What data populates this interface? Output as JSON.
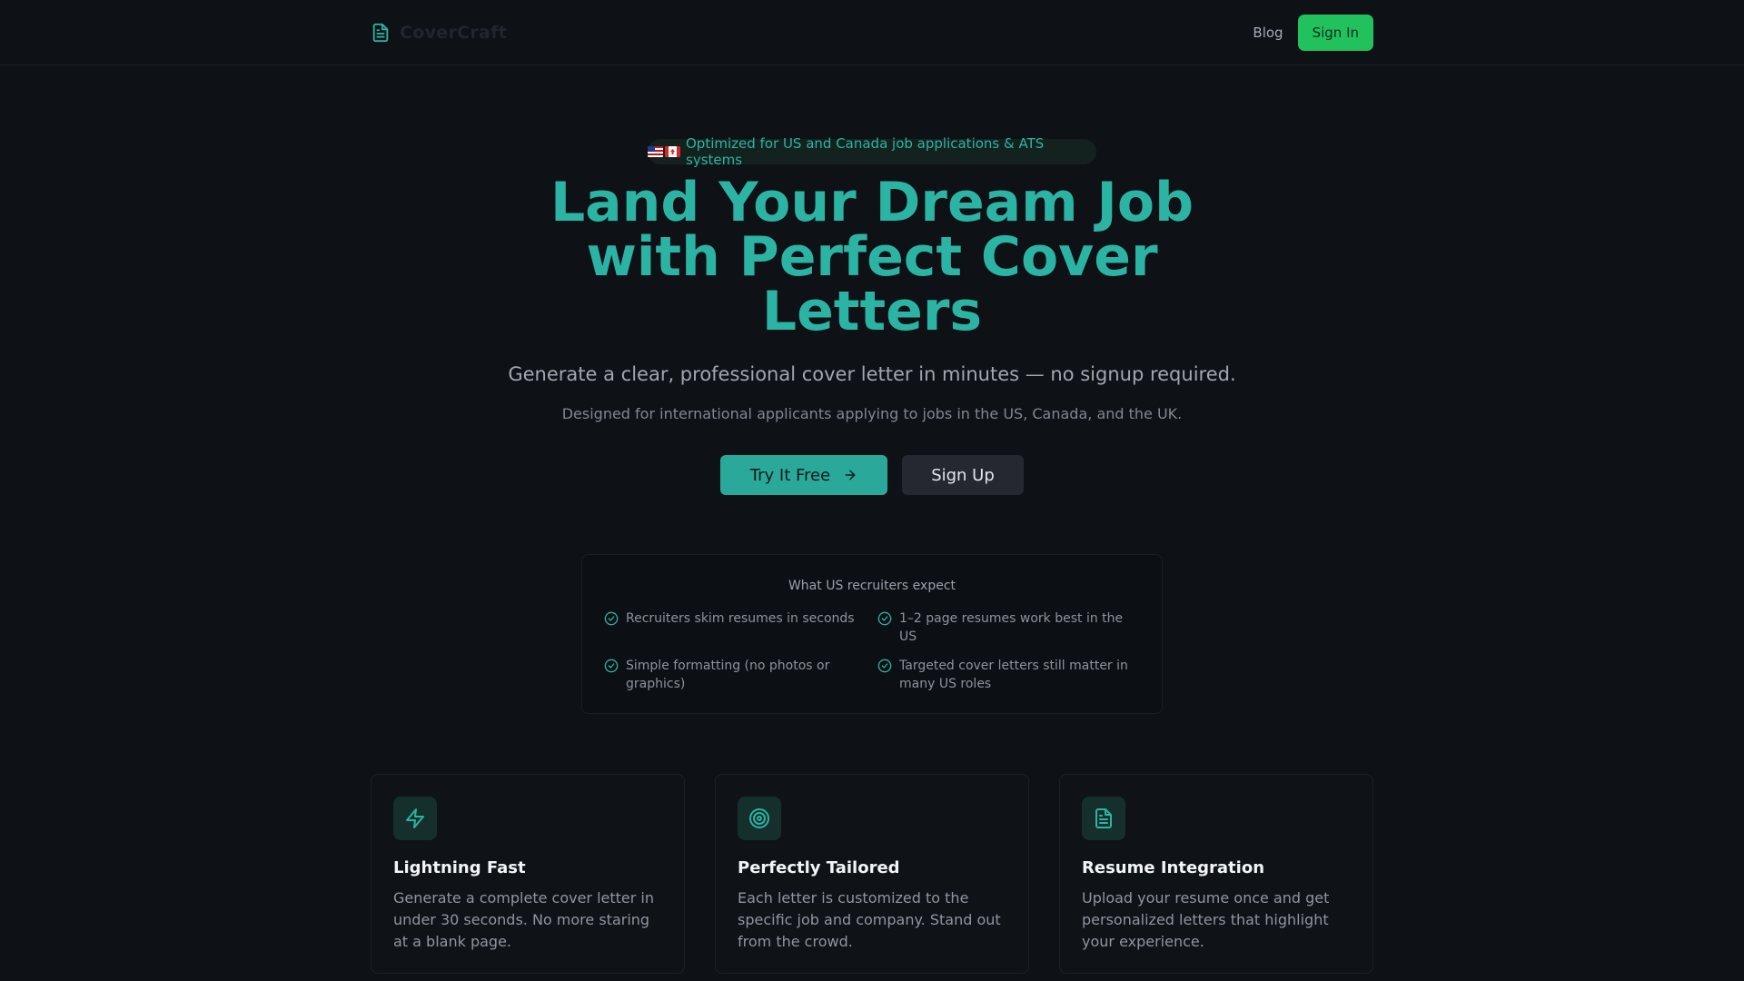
{
  "colors": {
    "accent": "#2bb3a3",
    "signin": "#21c25e",
    "background": "#0e1116"
  },
  "nav": {
    "brand_icon": "file-text-icon",
    "brand_name": "CoverCraft",
    "blog_label": "Blog",
    "signin_label": "Sign In"
  },
  "hero": {
    "badge_flags": [
      "us-flag",
      "canada-flag"
    ],
    "badge_text": "Optimized for US and Canada job applications & ATS systems",
    "title_lines": [
      "Land Your Dream Job",
      "with Perfect Cover",
      "Letters"
    ],
    "subtitle": "Generate a clear, professional cover letter in minutes — no signup required.",
    "subnote": "Designed for international applicants applying to jobs in the US, Canada, and the UK.",
    "primary_label": "Try It Free",
    "primary_icon": "arrow-right-icon",
    "secondary_label": "Sign Up"
  },
  "expect": {
    "title": "What US recruiters expect",
    "items": [
      "Recruiters skim resumes in seconds",
      "1–2 page resumes work best in the US",
      "Simple formatting (no photos or graphics)",
      "Targeted cover letters still matter in many US roles"
    ]
  },
  "features": [
    {
      "icon": "zap-icon",
      "title": "Lightning Fast",
      "desc": "Generate a complete cover letter in under 30 seconds. No more staring at a blank page."
    },
    {
      "icon": "target-icon",
      "title": "Perfectly Tailored",
      "desc": "Each letter is customized to the specific job and company. Stand out from the crowd."
    },
    {
      "icon": "file-text-icon",
      "title": "Resume Integration",
      "desc": "Upload your resume once and get personalized letters that highlight your experience."
    }
  ]
}
